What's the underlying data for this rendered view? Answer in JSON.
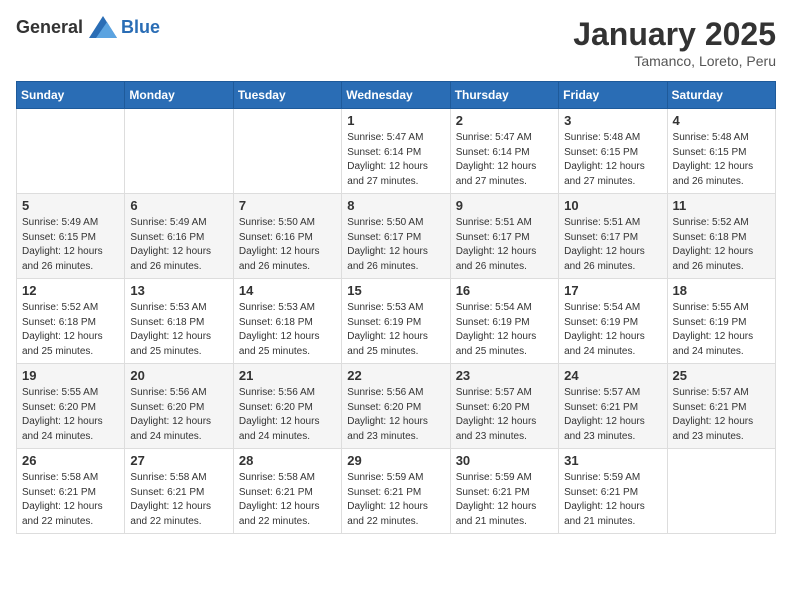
{
  "logo": {
    "general": "General",
    "blue": "Blue"
  },
  "header": {
    "month": "January 2025",
    "location": "Tamanco, Loreto, Peru"
  },
  "weekdays": [
    "Sunday",
    "Monday",
    "Tuesday",
    "Wednesday",
    "Thursday",
    "Friday",
    "Saturday"
  ],
  "weeks": [
    [
      {
        "day": "",
        "info": ""
      },
      {
        "day": "",
        "info": ""
      },
      {
        "day": "",
        "info": ""
      },
      {
        "day": "1",
        "info": "Sunrise: 5:47 AM\nSunset: 6:14 PM\nDaylight: 12 hours\nand 27 minutes."
      },
      {
        "day": "2",
        "info": "Sunrise: 5:47 AM\nSunset: 6:14 PM\nDaylight: 12 hours\nand 27 minutes."
      },
      {
        "day": "3",
        "info": "Sunrise: 5:48 AM\nSunset: 6:15 PM\nDaylight: 12 hours\nand 27 minutes."
      },
      {
        "day": "4",
        "info": "Sunrise: 5:48 AM\nSunset: 6:15 PM\nDaylight: 12 hours\nand 26 minutes."
      }
    ],
    [
      {
        "day": "5",
        "info": "Sunrise: 5:49 AM\nSunset: 6:15 PM\nDaylight: 12 hours\nand 26 minutes."
      },
      {
        "day": "6",
        "info": "Sunrise: 5:49 AM\nSunset: 6:16 PM\nDaylight: 12 hours\nand 26 minutes."
      },
      {
        "day": "7",
        "info": "Sunrise: 5:50 AM\nSunset: 6:16 PM\nDaylight: 12 hours\nand 26 minutes."
      },
      {
        "day": "8",
        "info": "Sunrise: 5:50 AM\nSunset: 6:17 PM\nDaylight: 12 hours\nand 26 minutes."
      },
      {
        "day": "9",
        "info": "Sunrise: 5:51 AM\nSunset: 6:17 PM\nDaylight: 12 hours\nand 26 minutes."
      },
      {
        "day": "10",
        "info": "Sunrise: 5:51 AM\nSunset: 6:17 PM\nDaylight: 12 hours\nand 26 minutes."
      },
      {
        "day": "11",
        "info": "Sunrise: 5:52 AM\nSunset: 6:18 PM\nDaylight: 12 hours\nand 26 minutes."
      }
    ],
    [
      {
        "day": "12",
        "info": "Sunrise: 5:52 AM\nSunset: 6:18 PM\nDaylight: 12 hours\nand 25 minutes."
      },
      {
        "day": "13",
        "info": "Sunrise: 5:53 AM\nSunset: 6:18 PM\nDaylight: 12 hours\nand 25 minutes."
      },
      {
        "day": "14",
        "info": "Sunrise: 5:53 AM\nSunset: 6:18 PM\nDaylight: 12 hours\nand 25 minutes."
      },
      {
        "day": "15",
        "info": "Sunrise: 5:53 AM\nSunset: 6:19 PM\nDaylight: 12 hours\nand 25 minutes."
      },
      {
        "day": "16",
        "info": "Sunrise: 5:54 AM\nSunset: 6:19 PM\nDaylight: 12 hours\nand 25 minutes."
      },
      {
        "day": "17",
        "info": "Sunrise: 5:54 AM\nSunset: 6:19 PM\nDaylight: 12 hours\nand 24 minutes."
      },
      {
        "day": "18",
        "info": "Sunrise: 5:55 AM\nSunset: 6:19 PM\nDaylight: 12 hours\nand 24 minutes."
      }
    ],
    [
      {
        "day": "19",
        "info": "Sunrise: 5:55 AM\nSunset: 6:20 PM\nDaylight: 12 hours\nand 24 minutes."
      },
      {
        "day": "20",
        "info": "Sunrise: 5:56 AM\nSunset: 6:20 PM\nDaylight: 12 hours\nand 24 minutes."
      },
      {
        "day": "21",
        "info": "Sunrise: 5:56 AM\nSunset: 6:20 PM\nDaylight: 12 hours\nand 24 minutes."
      },
      {
        "day": "22",
        "info": "Sunrise: 5:56 AM\nSunset: 6:20 PM\nDaylight: 12 hours\nand 23 minutes."
      },
      {
        "day": "23",
        "info": "Sunrise: 5:57 AM\nSunset: 6:20 PM\nDaylight: 12 hours\nand 23 minutes."
      },
      {
        "day": "24",
        "info": "Sunrise: 5:57 AM\nSunset: 6:21 PM\nDaylight: 12 hours\nand 23 minutes."
      },
      {
        "day": "25",
        "info": "Sunrise: 5:57 AM\nSunset: 6:21 PM\nDaylight: 12 hours\nand 23 minutes."
      }
    ],
    [
      {
        "day": "26",
        "info": "Sunrise: 5:58 AM\nSunset: 6:21 PM\nDaylight: 12 hours\nand 22 minutes."
      },
      {
        "day": "27",
        "info": "Sunrise: 5:58 AM\nSunset: 6:21 PM\nDaylight: 12 hours\nand 22 minutes."
      },
      {
        "day": "28",
        "info": "Sunrise: 5:58 AM\nSunset: 6:21 PM\nDaylight: 12 hours\nand 22 minutes."
      },
      {
        "day": "29",
        "info": "Sunrise: 5:59 AM\nSunset: 6:21 PM\nDaylight: 12 hours\nand 22 minutes."
      },
      {
        "day": "30",
        "info": "Sunrise: 5:59 AM\nSunset: 6:21 PM\nDaylight: 12 hours\nand 21 minutes."
      },
      {
        "day": "31",
        "info": "Sunrise: 5:59 AM\nSunset: 6:21 PM\nDaylight: 12 hours\nand 21 minutes."
      },
      {
        "day": "",
        "info": ""
      }
    ]
  ]
}
